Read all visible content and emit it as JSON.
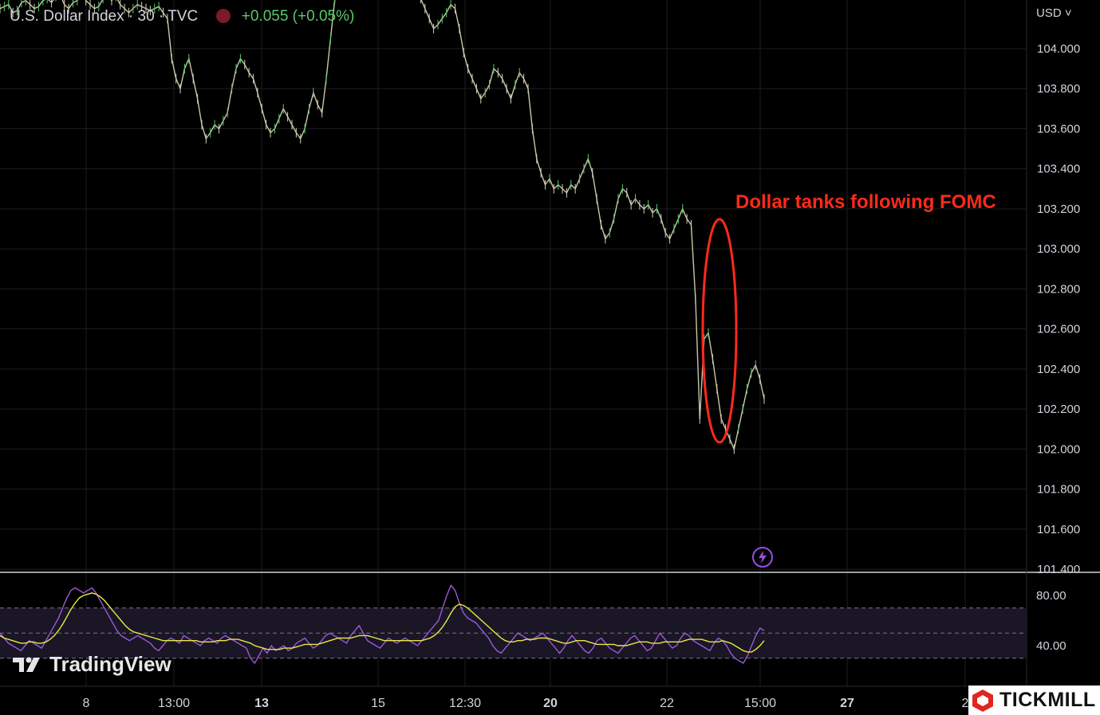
{
  "header": {
    "symbol": "U.S. Dollar Index · 30 · TVC",
    "change": "+0.055 (+0.05%)"
  },
  "currency": "USD ˅",
  "annotation": "Dollar tanks following FOMC",
  "branding": {
    "tradingview": "TradingView",
    "broker": "TICKMILL"
  },
  "icons": {
    "lightning": "lightning-icon",
    "flag": "flag-icon"
  },
  "colors": {
    "up": "#5ac86a",
    "down": "#d0d0b8",
    "rsi": "#9b59d6",
    "rsi_ma": "#e8e845",
    "annotation": "#ff2a1a"
  },
  "chart_data": [
    {
      "type": "line",
      "title": "",
      "x_ticks": [
        "8",
        "13:00",
        "13",
        "15",
        "12:30",
        "20",
        "22",
        "15:00",
        "27",
        "2"
      ],
      "y_ticks": [
        "104.000",
        "103.800",
        "103.600",
        "103.400",
        "103.200",
        "103.000",
        "102.800",
        "102.600",
        "102.400",
        "102.200",
        "102.000",
        "101.800",
        "101.600",
        "101.400"
      ],
      "ylim": [
        101.4,
        104.2
      ],
      "grid": true,
      "series": [
        {
          "values": [
            104.2,
            104.21,
            104.22,
            104.18,
            104.19,
            104.23,
            104.24,
            104.22,
            104.2,
            104.21,
            104.24,
            104.25,
            104.23,
            104.26,
            104.27,
            104.22,
            104.2,
            104.23,
            104.24,
            104.28,
            104.24,
            104.22,
            104.2,
            104.21,
            104.25,
            104.27,
            104.24,
            104.26,
            104.22,
            104.2,
            104.18,
            104.2,
            104.22,
            104.21,
            104.2,
            104.19,
            104.2,
            104.21,
            104.18,
            104.15,
            103.95,
            103.85,
            103.8,
            103.9,
            103.95,
            103.85,
            103.75,
            103.62,
            103.55,
            103.58,
            103.62,
            103.6,
            103.64,
            103.68,
            103.8,
            103.9,
            103.95,
            103.92,
            103.88,
            103.85,
            103.78,
            103.7,
            103.62,
            103.58,
            103.6,
            103.65,
            103.7,
            103.66,
            103.62,
            103.58,
            103.55,
            103.6,
            103.7,
            103.78,
            103.72,
            103.68,
            103.85,
            104.05,
            104.25,
            104.3,
            104.28,
            104.32,
            104.35,
            104.4,
            104.38,
            104.36,
            104.38,
            104.4,
            104.42,
            104.4,
            104.38,
            104.36,
            104.38,
            104.4,
            104.42,
            104.4,
            104.36,
            104.3,
            104.25,
            104.2,
            104.15,
            104.1,
            104.12,
            104.15,
            104.18,
            104.22,
            104.2,
            104.1,
            103.98,
            103.9,
            103.85,
            103.8,
            103.75,
            103.78,
            103.82,
            103.9,
            103.88,
            103.85,
            103.8,
            103.75,
            103.82,
            103.88,
            103.85,
            103.8,
            103.6,
            103.45,
            103.38,
            103.32,
            103.35,
            103.3,
            103.32,
            103.3,
            103.28,
            103.32,
            103.3,
            103.35,
            103.4,
            103.45,
            103.38,
            103.25,
            103.12,
            103.05,
            103.08,
            103.15,
            103.25,
            103.3,
            103.28,
            103.22,
            103.25,
            103.22,
            103.2,
            103.22,
            103.18,
            103.2,
            103.15,
            103.08,
            103.05,
            103.1,
            103.15,
            103.2,
            103.15,
            103.12,
            102.75,
            102.15,
            102.55,
            102.58,
            102.45,
            102.3,
            102.15,
            102.1,
            102.05,
            102.0,
            102.1,
            102.2,
            102.3,
            102.38,
            102.42,
            102.35,
            102.25
          ]
        }
      ]
    },
    {
      "type": "line",
      "title": "",
      "y_ticks": [
        "80.00",
        "40.00"
      ],
      "ylim": [
        20,
        95
      ],
      "bands": [
        70,
        50,
        30
      ],
      "series": [
        {
          "values": [
            50,
            46,
            42,
            40,
            38,
            36,
            40,
            44,
            42,
            40,
            38,
            44,
            50,
            56,
            62,
            70,
            78,
            84,
            86,
            84,
            82,
            84,
            86,
            82,
            76,
            70,
            64,
            58,
            52,
            48,
            46,
            44,
            46,
            48,
            46,
            44,
            42,
            38,
            36,
            40,
            44,
            46,
            44,
            42,
            48,
            46,
            44,
            42,
            40,
            44,
            46,
            44,
            42,
            46,
            48,
            46,
            44,
            42,
            40,
            38,
            30,
            26,
            32,
            38,
            34,
            40,
            36,
            38,
            40,
            36,
            38,
            42,
            44,
            46,
            42,
            38,
            40,
            44,
            48,
            50,
            48,
            46,
            44,
            42,
            48,
            52,
            56,
            50,
            44,
            42,
            40,
            38,
            42,
            46,
            44,
            42,
            44,
            46,
            44,
            42,
            40,
            44,
            48,
            52,
            56,
            60,
            70,
            80,
            88,
            84,
            74,
            66,
            62,
            60,
            58,
            54,
            50,
            46,
            40,
            36,
            34,
            38,
            42,
            46,
            50,
            48,
            46,
            44,
            46,
            48,
            50,
            46,
            42,
            38,
            34,
            38,
            44,
            48,
            44,
            40,
            36,
            34,
            38,
            44,
            46,
            42,
            38,
            36,
            34,
            38,
            42,
            46,
            48,
            44,
            40,
            36,
            38,
            44,
            50,
            46,
            42,
            38,
            40,
            46,
            50,
            48,
            44,
            42,
            40,
            38,
            36,
            42,
            46,
            44,
            40,
            34,
            30,
            28,
            26,
            32,
            40,
            48,
            54,
            52
          ]
        },
        {
          "values": [
            48,
            46,
            45,
            44,
            43,
            42,
            42,
            43,
            43,
            42,
            42,
            43,
            45,
            48,
            52,
            57,
            63,
            69,
            74,
            78,
            80,
            81,
            82,
            81,
            79,
            76,
            72,
            68,
            64,
            60,
            56,
            53,
            51,
            50,
            49,
            48,
            47,
            46,
            45,
            44,
            44,
            44,
            44,
            44,
            44,
            44,
            44,
            44,
            43,
            43,
            43,
            43,
            44,
            44,
            44,
            45,
            45,
            45,
            44,
            43,
            42,
            40,
            39,
            38,
            37,
            37,
            37,
            37,
            38,
            38,
            38,
            39,
            40,
            41,
            41,
            41,
            41,
            42,
            43,
            44,
            45,
            46,
            46,
            46,
            46,
            47,
            48,
            48,
            48,
            47,
            46,
            45,
            44,
            44,
            44,
            44,
            44,
            44,
            44,
            44,
            44,
            44,
            45,
            46,
            48,
            51,
            55,
            60,
            66,
            71,
            73,
            72,
            70,
            67,
            64,
            61,
            58,
            55,
            52,
            49,
            46,
            44,
            43,
            43,
            44,
            44,
            45,
            45,
            45,
            46,
            46,
            46,
            45,
            44,
            43,
            42,
            42,
            43,
            44,
            44,
            44,
            43,
            42,
            41,
            41,
            41,
            41,
            41,
            40,
            40,
            40,
            41,
            42,
            43,
            43,
            43,
            42,
            42,
            42,
            43,
            43,
            43,
            43,
            43,
            44,
            45,
            45,
            45,
            45,
            44,
            43,
            43,
            43,
            44,
            43,
            42,
            40,
            38,
            36,
            35,
            35,
            37,
            40,
            44
          ]
        }
      ]
    }
  ]
}
